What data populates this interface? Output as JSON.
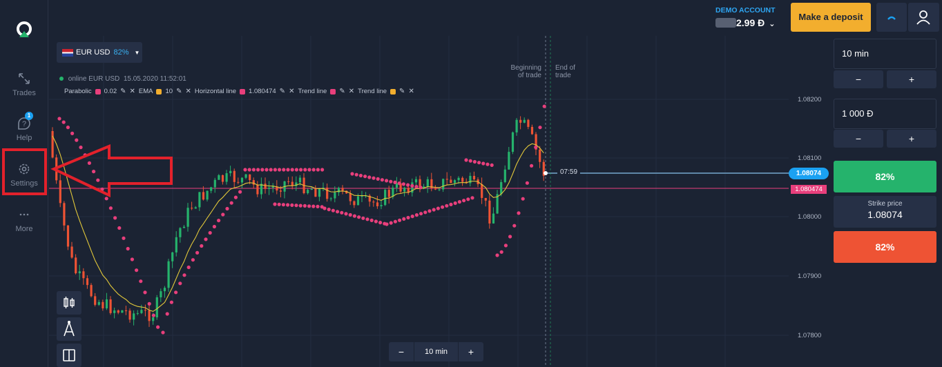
{
  "sidebar": {
    "items": [
      {
        "label": "Trades"
      },
      {
        "label": "Help",
        "badge": "1"
      },
      {
        "label": "Settings"
      },
      {
        "label": "More"
      }
    ]
  },
  "header": {
    "account_type": "DEMO ACCOUNT",
    "balance_visible": "2.99 Đ",
    "deposit_label": "Make a deposit"
  },
  "chart_toolbar": {
    "pair": "EUR USD",
    "payout": "82%",
    "status": "online EUR USD",
    "datetime": "15.05.2020 11:52:01"
  },
  "indicators": [
    {
      "name": "Parabolic",
      "color": "#e83f7c",
      "value": "0.02"
    },
    {
      "name": "EMA",
      "color": "#f2ae2e",
      "value": "10"
    },
    {
      "name": "Horizontal line",
      "color": "#e83f7c",
      "value": "1.080474"
    },
    {
      "name": "Trend line",
      "color": "#e83f7c",
      "value": ""
    },
    {
      "name": "Trend line",
      "color": "#f2ae2e",
      "value": ""
    }
  ],
  "chart": {
    "beginning_label": "Beginning of trade",
    "end_label": "End of trade",
    "current_price": "1.08074",
    "horizontal_line": "1.080474",
    "countdown": "07:59",
    "y_ticks": [
      "1.08200",
      "1.08100",
      "1.08000",
      "1.07900",
      "1.07800"
    ]
  },
  "timeframe_bar": {
    "minus": "−",
    "value": "10 min",
    "plus": "+"
  },
  "trade_panel": {
    "duration": "10 min",
    "amount": "1 000 Đ",
    "minus": "−",
    "plus": "+",
    "up_label": "82%",
    "strike_label": "Strike price",
    "strike_value": "1.08074",
    "down_label": "82%"
  },
  "colors": {
    "bull": "#25b36c",
    "bear": "#ee5334",
    "sar": "#e83f7c",
    "ema": "#e2c83a",
    "accent": "#1ba1f2",
    "deposit": "#f2ae2e",
    "annotation": "#e3212b"
  }
}
